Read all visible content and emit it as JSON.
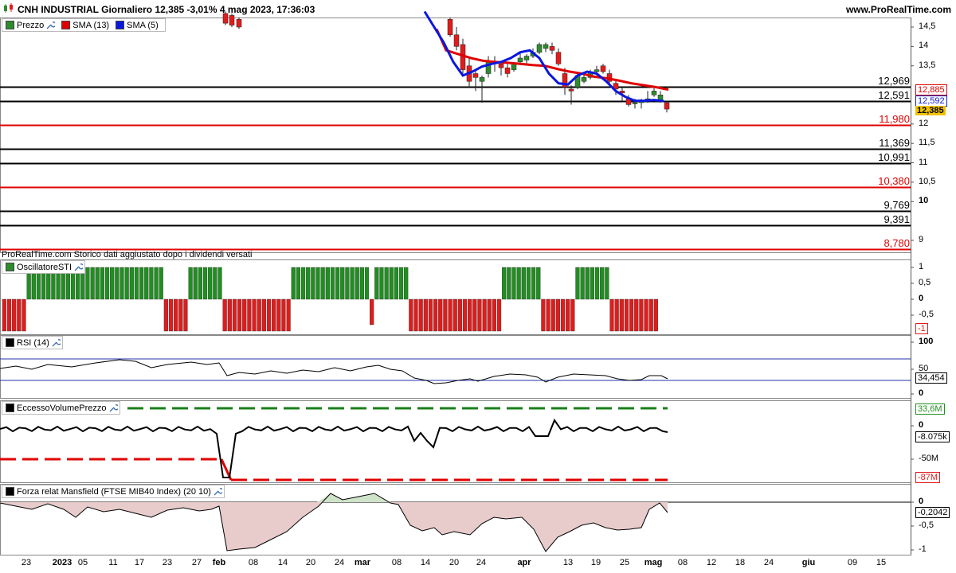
{
  "header": {
    "title": "CNH INDUSTRIAL Giornaliero 12,385 -3,01% 4 mag 2023, 17:36:03",
    "site": "www.ProRealTime.com"
  },
  "colors": {
    "up": "#2e8b2e",
    "down": "#e21b1b",
    "sma13": "#e00000",
    "sma5": "#0a17e0",
    "level_black": "#000000",
    "level_red": "#e00000",
    "stoch_green": "#1f8f1f",
    "stoch_red": "#e21b1b",
    "mansfield_pos": "#cfe3c9",
    "mansfield_neg": "#e8cccc"
  },
  "price_panel": {
    "legend": [
      {
        "label": "Prezzo",
        "icon": "candle-icon"
      },
      {
        "label": "SMA (13)",
        "color": "#e00000"
      },
      {
        "label": "SMA (5)",
        "color": "#0a17e0"
      }
    ],
    "axis_ticks": [
      "14,5",
      "14",
      "13,5",
      "13",
      "12,5",
      "12",
      "11,5",
      "11",
      "10,5",
      "10",
      "9"
    ],
    "levels": [
      {
        "value": 12.969,
        "label": "12,969",
        "color": "black"
      },
      {
        "value": 12.591,
        "label": "12,591",
        "color": "black"
      },
      {
        "value": 11.98,
        "label": "11,980",
        "color": "red"
      },
      {
        "value": 11.369,
        "label": "11,369",
        "color": "black"
      },
      {
        "value": 10.991,
        "label": "10,991",
        "color": "black"
      },
      {
        "value": 10.38,
        "label": "10,380",
        "color": "red"
      },
      {
        "value": 9.769,
        "label": "9,769",
        "color": "black"
      },
      {
        "value": 9.391,
        "label": "9,391",
        "color": "black"
      },
      {
        "value": 8.78,
        "label": "8,780",
        "color": "red"
      }
    ],
    "price_tags": [
      {
        "label": "12,885",
        "color": "red"
      },
      {
        "label": "12,592",
        "color": "blue"
      },
      {
        "label": "12,385",
        "color": "gold"
      }
    ],
    "note": "ProRealTime.com Storico dati aggiustato dopo i dividendi versati"
  },
  "stoch_panel": {
    "legend": "OscillatoreSTI",
    "axis_ticks": [
      "1",
      "0,5",
      "0",
      "-0,5"
    ],
    "last_label": "-1"
  },
  "rsi_panel": {
    "legend": "RSI (14)",
    "axis_ticks": [
      "100",
      "50",
      "0"
    ],
    "last_label": "34,454"
  },
  "volume_panel": {
    "legend": "EccessoVolumePrezzo",
    "axis_ticks": [
      "0",
      "-50M"
    ],
    "upper_label": "33,6M",
    "last_label": "-8.075k",
    "lower_label": "-87M"
  },
  "mansfield_panel": {
    "legend": "Forza relat Mansfield (FTSE MIB40 Index) (20 10)",
    "axis_ticks": [
      "0",
      "-0,5",
      "-1"
    ],
    "last_label": "-0,2042"
  },
  "x_axis": {
    "labels": [
      {
        "t": "23"
      },
      {
        "t": "2023",
        "b": true
      },
      {
        "t": "05"
      },
      {
        "t": "11"
      },
      {
        "t": "17"
      },
      {
        "t": "23"
      },
      {
        "t": "27"
      },
      {
        "t": "feb",
        "b": true
      },
      {
        "t": "08"
      },
      {
        "t": "14"
      },
      {
        "t": "20"
      },
      {
        "t": "24"
      },
      {
        "t": "mar",
        "b": true
      },
      {
        "t": "08"
      },
      {
        "t": "14"
      },
      {
        "t": "20"
      },
      {
        "t": "24"
      },
      {
        "t": "apr",
        "b": true
      },
      {
        "t": "13"
      },
      {
        "t": "19"
      },
      {
        "t": "25"
      },
      {
        "t": "mag",
        "b": true
      },
      {
        "t": "08"
      },
      {
        "t": "12"
      },
      {
        "t": "18"
      },
      {
        "t": "24"
      },
      {
        "t": "giu",
        "b": true
      },
      {
        "t": "09"
      },
      {
        "t": "15"
      }
    ]
  },
  "chart_data": {
    "type": "candlestick",
    "instrument": "CNH INDUSTRIAL",
    "timeframe": "Giornaliero",
    "last": 12.385,
    "change": "-3,01%",
    "ylim": [
      8.7,
      14.7
    ],
    "visible_candles": [
      {
        "o": 14.9,
        "h": 14.95,
        "l": 14.55,
        "c": 14.7
      },
      {
        "o": 14.85,
        "h": 14.9,
        "l": 14.55,
        "c": 14.65
      },
      {
        "o": 14.8,
        "h": 14.95,
        "l": 14.6,
        "c": 14.9
      },
      {
        "o": 14.9,
        "h": 15.0,
        "l": 14.7,
        "c": 14.85
      },
      {
        "o": 14.75,
        "h": 14.8,
        "l": 14.6,
        "c": 14.7
      },
      {
        "o": 14.65,
        "h": 14.75,
        "l": 14.45,
        "c": 14.55
      },
      {
        "o": 14.7,
        "h": 14.75,
        "l": 14.25,
        "c": 14.3
      },
      {
        "o": 14.3,
        "h": 14.5,
        "l": 13.9,
        "c": 14.0
      },
      {
        "o": 14.05,
        "h": 14.2,
        "l": 13.3,
        "c": 13.4
      },
      {
        "o": 13.5,
        "h": 13.7,
        "l": 12.95,
        "c": 13.1
      },
      {
        "o": 13.3,
        "h": 13.4,
        "l": 12.85,
        "c": 13.2
      },
      {
        "o": 13.1,
        "h": 13.25,
        "l": 12.55,
        "c": 13.2
      },
      {
        "o": 13.3,
        "h": 13.75,
        "l": 13.2,
        "c": 13.6
      },
      {
        "o": 13.6,
        "h": 13.75,
        "l": 13.35,
        "c": 13.55
      },
      {
        "o": 13.55,
        "h": 13.6,
        "l": 13.25,
        "c": 13.45
      },
      {
        "o": 13.45,
        "h": 13.55,
        "l": 13.2,
        "c": 13.3
      },
      {
        "o": 13.4,
        "h": 13.6,
        "l": 13.35,
        "c": 13.55
      },
      {
        "o": 13.6,
        "h": 13.85,
        "l": 13.55,
        "c": 13.7
      },
      {
        "o": 13.65,
        "h": 13.8,
        "l": 13.55,
        "c": 13.75
      },
      {
        "o": 13.75,
        "h": 13.95,
        "l": 13.7,
        "c": 13.85
      },
      {
        "o": 13.85,
        "h": 14.1,
        "l": 13.8,
        "c": 14.05
      },
      {
        "o": 13.95,
        "h": 14.1,
        "l": 13.85,
        "c": 14.05
      },
      {
        "o": 14.0,
        "h": 14.1,
        "l": 13.8,
        "c": 13.9
      },
      {
        "o": 13.85,
        "h": 13.95,
        "l": 13.5,
        "c": 13.55
      },
      {
        "o": 13.3,
        "h": 13.45,
        "l": 12.75,
        "c": 12.95
      },
      {
        "o": 12.9,
        "h": 13.0,
        "l": 12.5,
        "c": 12.85
      },
      {
        "o": 12.95,
        "h": 13.3,
        "l": 12.9,
        "c": 13.25
      },
      {
        "o": 13.1,
        "h": 13.3,
        "l": 13.05,
        "c": 13.2
      },
      {
        "o": 13.2,
        "h": 13.4,
        "l": 13.15,
        "c": 13.35
      },
      {
        "o": 13.35,
        "h": 13.5,
        "l": 13.25,
        "c": 13.4
      },
      {
        "o": 13.5,
        "h": 13.55,
        "l": 13.3,
        "c": 13.35
      },
      {
        "o": 13.3,
        "h": 13.4,
        "l": 13.05,
        "c": 13.1
      },
      {
        "o": 13.05,
        "h": 13.15,
        "l": 12.75,
        "c": 12.9
      },
      {
        "o": 12.85,
        "h": 12.95,
        "l": 12.6,
        "c": 12.8
      },
      {
        "o": 12.65,
        "h": 12.75,
        "l": 12.45,
        "c": 12.5
      },
      {
        "o": 12.55,
        "h": 12.65,
        "l": 12.4,
        "c": 12.55
      },
      {
        "o": 12.55,
        "h": 12.65,
        "l": 12.4,
        "c": 12.6
      },
      {
        "o": 12.6,
        "h": 12.85,
        "l": 12.55,
        "c": 12.65
      },
      {
        "o": 12.75,
        "h": 12.95,
        "l": 12.7,
        "c": 12.85
      },
      {
        "o": 12.6,
        "h": 12.85,
        "l": 12.55,
        "c": 12.75
      },
      {
        "o": 12.55,
        "h": 12.6,
        "l": 12.3,
        "c": 12.385
      }
    ],
    "sma13_points": [
      13.9,
      13.8,
      13.7,
      13.63,
      13.6,
      13.58,
      13.55,
      13.52,
      13.5,
      13.42,
      13.35,
      13.3,
      13.22,
      13.18,
      13.12,
      13.05,
      13.0,
      12.95,
      12.885
    ],
    "sma5_points": [
      14.9,
      14.5,
      14.1,
      13.6,
      13.25,
      13.35,
      13.48,
      13.55,
      13.6,
      13.7,
      13.85,
      13.9,
      13.7,
      13.3,
      13.05,
      13.02,
      13.25,
      13.35,
      13.3,
      13.1,
      12.85,
      12.7,
      12.6,
      12.6,
      12.62,
      12.592
    ],
    "stoch_bars": [
      -1,
      -1,
      -1,
      -1,
      -1,
      1,
      1,
      1,
      1,
      1,
      1,
      1,
      1,
      1,
      1,
      1,
      1,
      1,
      1,
      1,
      1,
      1,
      1,
      1,
      1,
      1,
      1,
      1,
      1,
      1,
      1,
      1,
      1,
      -1,
      -1,
      -1,
      -1,
      -1,
      1,
      1,
      1,
      1,
      1,
      1,
      1,
      -1,
      -1,
      -1,
      -1,
      -1,
      -1,
      -1,
      -1,
      -1,
      -1,
      -1,
      -1,
      -1,
      -1,
      1,
      1,
      1,
      1,
      1,
      1,
      1,
      1,
      1,
      1,
      1,
      1,
      1,
      1,
      1,
      1,
      -0.8,
      1,
      1,
      1,
      1,
      1,
      1,
      1,
      -1,
      -1,
      -1,
      -1,
      -1,
      -1,
      -1,
      -1,
      -1,
      -1,
      -1,
      -1,
      -1,
      -1,
      -1,
      -1,
      -1,
      -1,
      -1,
      1,
      1,
      1,
      1,
      1,
      1,
      1,
      1,
      -1,
      -1,
      -1,
      -1,
      -1,
      -1,
      -1,
      1,
      1,
      1,
      1,
      1,
      1,
      1,
      -1,
      -1,
      -1,
      -1,
      -1,
      -1,
      -1,
      -1,
      -1,
      -1
    ],
    "rsi_value": 34.454,
    "volume_last": -8075,
    "mansfield_last": -0.2042
  }
}
